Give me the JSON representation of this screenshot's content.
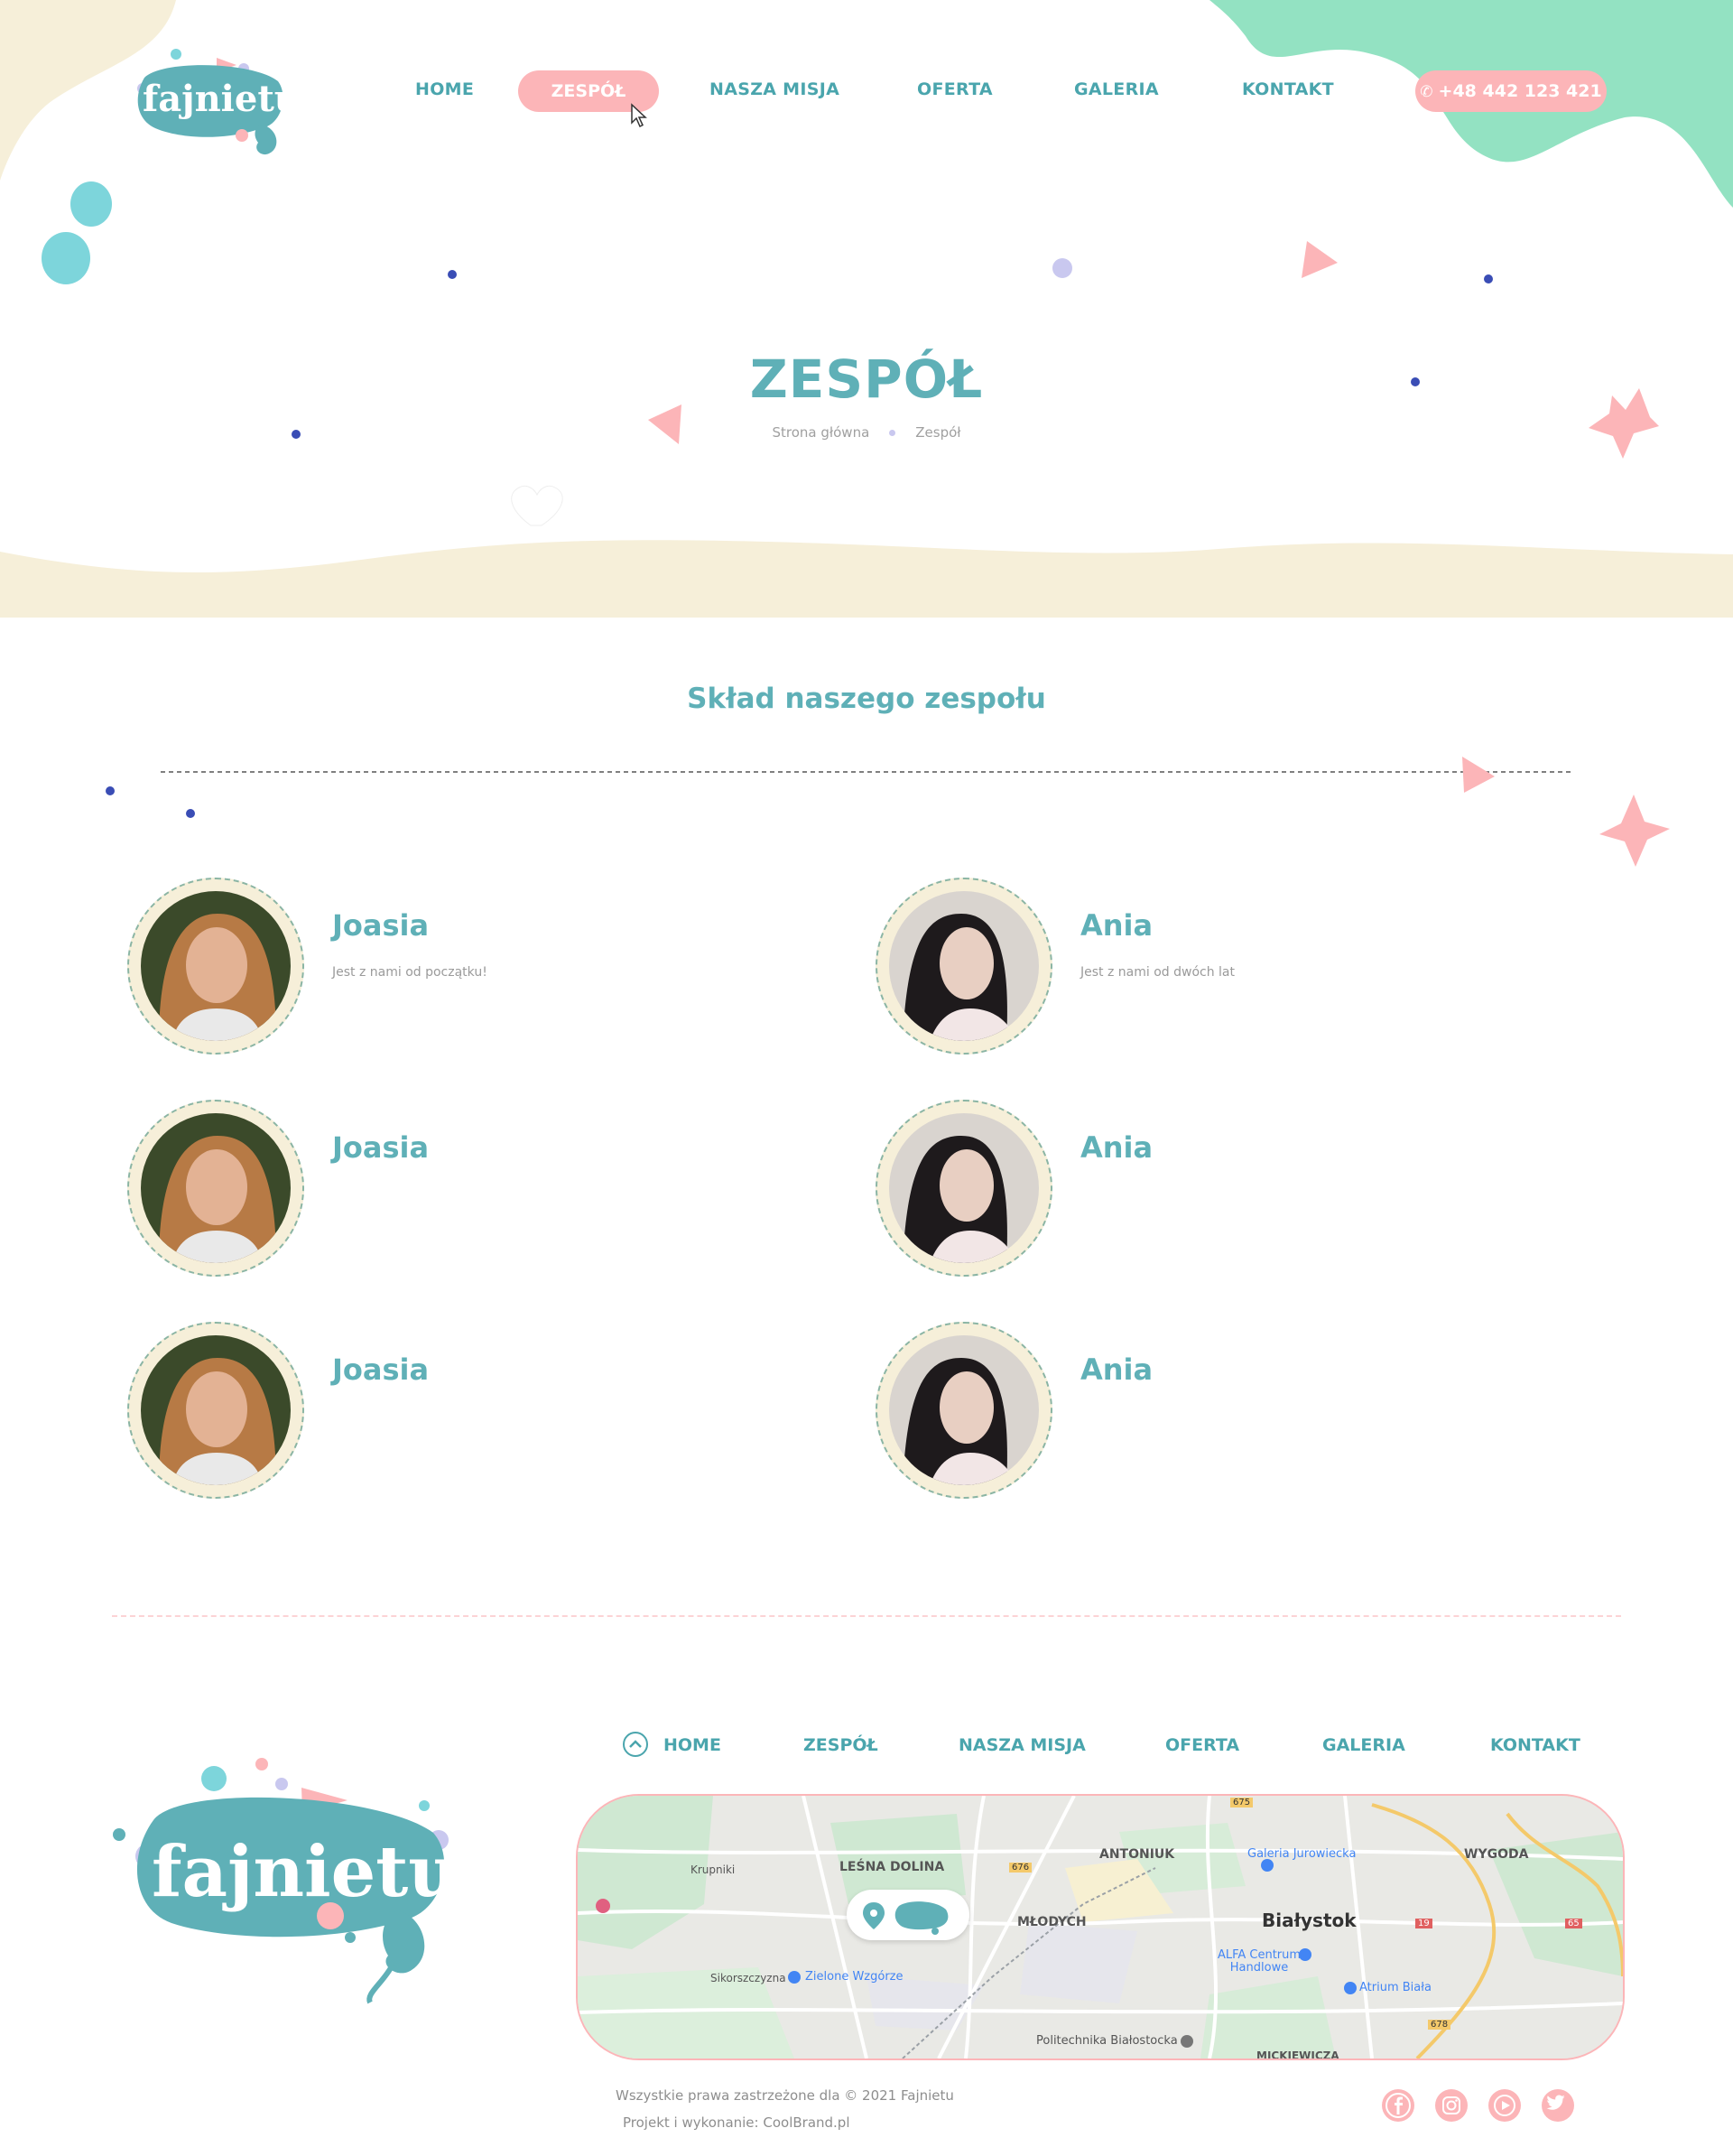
{
  "header": {
    "nav": [
      "HOME",
      "ZESPÓŁ",
      "NASZA MISJA",
      "OFERTA",
      "GALERIA",
      "KONTAKT"
    ],
    "active": "ZESPÓŁ",
    "phone": "+48 442 123 421",
    "logo_text": "fajnietu"
  },
  "hero": {
    "title": "ZESPÓŁ",
    "breadcrumb": [
      "Strona główna",
      "Zespół"
    ]
  },
  "team": {
    "title": "Skład naszego zespołu",
    "members": [
      {
        "name": "Joasia",
        "desc": "Jest z nami od początku!"
      },
      {
        "name": "Ania",
        "desc": "Jest z nami od dwóch lat"
      },
      {
        "name": "Joasia",
        "desc": ""
      },
      {
        "name": "Ania",
        "desc": ""
      },
      {
        "name": "Joasia",
        "desc": ""
      },
      {
        "name": "Ania",
        "desc": ""
      }
    ]
  },
  "footer": {
    "nav": [
      "HOME",
      "ZESPÓŁ",
      "NASZA MISJA",
      "OFERTA",
      "GALERIA",
      "KONTAKT"
    ],
    "logo_text": "fajnietu",
    "copyright": "Wszystkie prawa zastrzeżone dla © 2021 Fajnietu",
    "credit": "Projekt i wykonanie: CoolBrand.pl",
    "social": [
      "facebook-icon",
      "instagram-icon",
      "youtube-icon",
      "twitter-icon"
    ]
  },
  "map": {
    "labels": [
      "LEŚNA DOLINA",
      "ANTONIUK",
      "Galeria Jurowiecka",
      "WYGODA",
      "Krupniki",
      "MŁODYCH",
      "Białystok",
      "ALFA Centrum Handlowe",
      "Atrium Biała",
      "Zielone Wzgórze",
      "Sikorszczyzna",
      "Politechnika Białostocka",
      "675",
      "676",
      "678",
      "19",
      "65",
      "MICKIEWICZA"
    ]
  },
  "colors": {
    "teal": "#5fb0b7",
    "pink": "#fcb5b8",
    "mint": "#93e2c2",
    "cream": "#f6efd9",
    "navy_dot": "#3a4db5"
  }
}
